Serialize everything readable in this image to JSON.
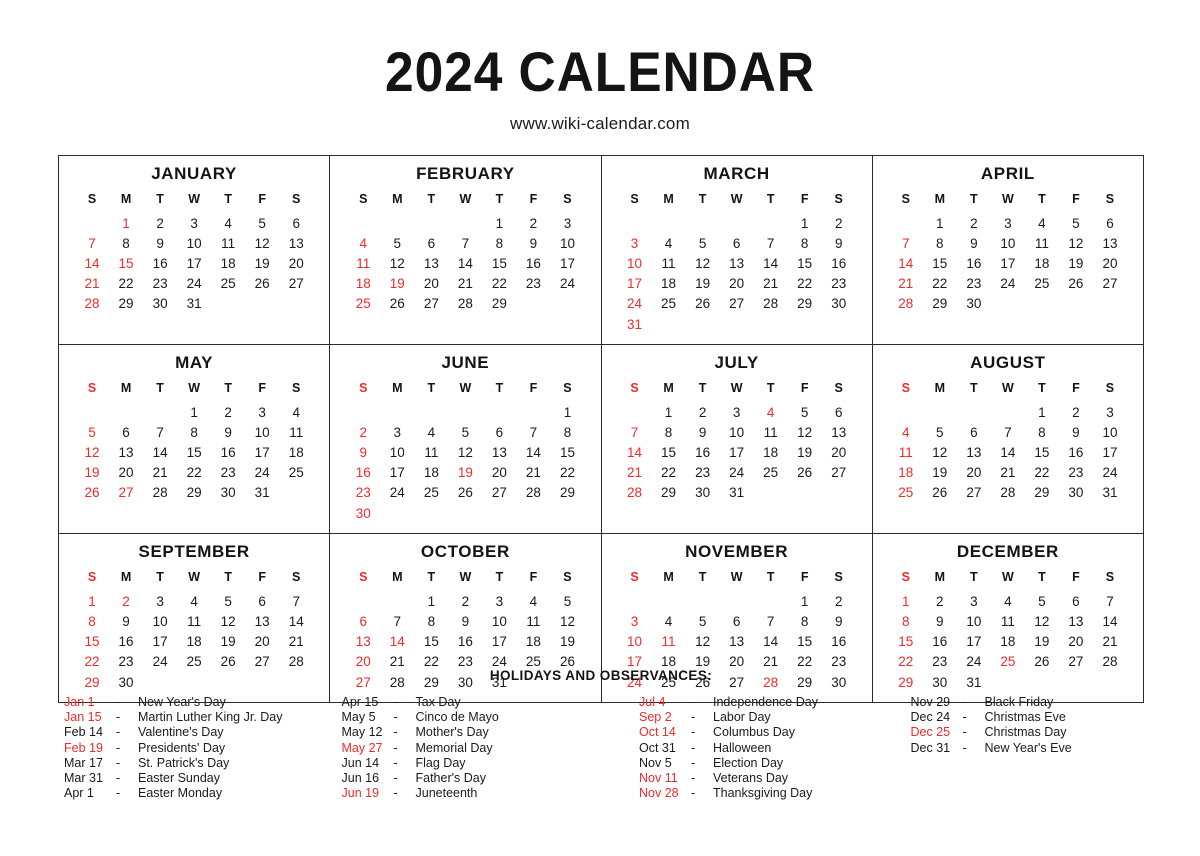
{
  "header": {
    "title": "2024 CALENDAR",
    "subtitle": "www.wiki-calendar.com"
  },
  "colors": {
    "accent_red": "#ef2b2b",
    "text_black": "#1b1b1b",
    "border": "#2b2b2b",
    "background": "#ffffff"
  },
  "weekday_headers": [
    "S",
    "M",
    "T",
    "W",
    "T",
    "F",
    "S"
  ],
  "months": [
    {
      "name": "JANUARY",
      "sunday_header_red": false,
      "lead_blank": 1,
      "days": 31,
      "red_days": [
        1,
        7,
        14,
        15,
        21,
        28
      ]
    },
    {
      "name": "FEBRUARY",
      "sunday_header_red": false,
      "lead_blank": 4,
      "days": 29,
      "red_days": [
        4,
        11,
        18,
        19,
        25
      ]
    },
    {
      "name": "MARCH",
      "sunday_header_red": false,
      "lead_blank": 5,
      "days": 31,
      "red_days": [
        3,
        10,
        17,
        24,
        31
      ]
    },
    {
      "name": "APRIL",
      "sunday_header_red": false,
      "lead_blank": 1,
      "days": 30,
      "red_days": [
        7,
        14,
        21,
        28
      ]
    },
    {
      "name": "MAY",
      "sunday_header_red": true,
      "lead_blank": 3,
      "days": 31,
      "red_days": [
        5,
        12,
        19,
        26,
        27
      ]
    },
    {
      "name": "JUNE",
      "sunday_header_red": true,
      "lead_blank": 6,
      "days": 30,
      "red_days": [
        2,
        9,
        16,
        19,
        23,
        30
      ]
    },
    {
      "name": "JULY",
      "sunday_header_red": true,
      "lead_blank": 1,
      "days": 31,
      "red_days": [
        4,
        7,
        14,
        21,
        28
      ]
    },
    {
      "name": "AUGUST",
      "sunday_header_red": true,
      "lead_blank": 4,
      "days": 31,
      "red_days": [
        4,
        11,
        18,
        25
      ]
    },
    {
      "name": "SEPTEMBER",
      "sunday_header_red": true,
      "lead_blank": 0,
      "days": 30,
      "red_days": [
        1,
        2,
        8,
        15,
        22,
        29
      ]
    },
    {
      "name": "OCTOBER",
      "sunday_header_red": true,
      "lead_blank": 2,
      "days": 31,
      "red_days": [
        6,
        13,
        14,
        20,
        27
      ]
    },
    {
      "name": "NOVEMBER",
      "sunday_header_red": true,
      "lead_blank": 5,
      "days": 30,
      "red_days": [
        3,
        10,
        11,
        17,
        24,
        28
      ]
    },
    {
      "name": "DECEMBER",
      "sunday_header_red": true,
      "lead_blank": 0,
      "days": 31,
      "red_days": [
        1,
        8,
        15,
        22,
        25,
        29
      ]
    }
  ],
  "holidays": {
    "title": "HOLIDAYS AND OBSERVANCES:",
    "separator": "-",
    "columns": [
      [
        {
          "date": "Jan 1",
          "name": "New Year's Day",
          "red": true
        },
        {
          "date": "Jan 15",
          "name": "Martin Luther King Jr. Day",
          "red": true
        },
        {
          "date": "Feb 14",
          "name": "Valentine's Day",
          "red": false
        },
        {
          "date": "Feb 19",
          "name": "Presidents' Day",
          "red": true
        },
        {
          "date": "Mar 17",
          "name": "St. Patrick's Day",
          "red": false
        },
        {
          "date": "Mar 31",
          "name": "Easter Sunday",
          "red": false
        },
        {
          "date": "Apr 1",
          "name": "Easter Monday",
          "red": false
        }
      ],
      [
        {
          "date": "Apr 15",
          "name": "Tax Day",
          "red": false
        },
        {
          "date": "May 5",
          "name": "Cinco de Mayo",
          "red": false
        },
        {
          "date": "May 12",
          "name": "Mother's Day",
          "red": false
        },
        {
          "date": "May 27",
          "name": "Memorial Day",
          "red": true
        },
        {
          "date": "Jun 14",
          "name": "Flag Day",
          "red": false
        },
        {
          "date": "Jun 16",
          "name": "Father's Day",
          "red": false
        },
        {
          "date": "Jun 19",
          "name": "Juneteenth",
          "red": true
        }
      ],
      [
        {
          "date": "Jul 4",
          "name": "Independence Day",
          "red": true
        },
        {
          "date": "Sep 2",
          "name": "Labor Day",
          "red": true
        },
        {
          "date": "Oct 14",
          "name": "Columbus Day",
          "red": true
        },
        {
          "date": "Oct 31",
          "name": "Halloween",
          "red": false
        },
        {
          "date": "Nov 5",
          "name": "Election Day",
          "red": false
        },
        {
          "date": "Nov 11",
          "name": "Veterans Day",
          "red": true
        },
        {
          "date": "Nov 28",
          "name": "Thanksgiving Day",
          "red": true
        }
      ],
      [
        {
          "date": "Nov 29",
          "name": "Black Friday",
          "red": false
        },
        {
          "date": "Dec 24",
          "name": "Christmas Eve",
          "red": false
        },
        {
          "date": "Dec 25",
          "name": "Christmas Day",
          "red": true
        },
        {
          "date": "Dec 31",
          "name": "New Year's Eve",
          "red": false
        }
      ]
    ]
  }
}
